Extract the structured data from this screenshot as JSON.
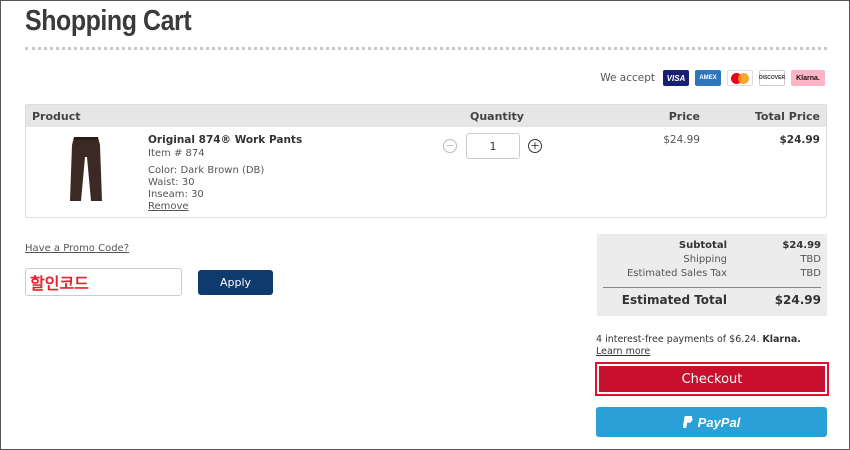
{
  "page": {
    "title": "Shopping Cart"
  },
  "payment": {
    "label": "We accept",
    "cards": [
      "VISA",
      "AMEX",
      "",
      "DISCOVER",
      "Klarna."
    ]
  },
  "table": {
    "headers": {
      "product": "Product",
      "quantity": "Quantity",
      "price": "Price",
      "total": "Total Price"
    }
  },
  "item": {
    "name": "Original 874® Work Pants",
    "item_no": "Item # 874",
    "color": "Color: Dark Brown (DB)",
    "waist": "Waist: 30",
    "inseam": "Inseam: 30",
    "remove": "Remove",
    "quantity": "1",
    "price": "$24.99",
    "total": "$24.99",
    "pants_color": "#3b2a23"
  },
  "promo": {
    "link": "Have a Promo Code?",
    "value": "할인코드",
    "apply": "Apply"
  },
  "summary": {
    "subtotal_label": "Subtotal",
    "subtotal": "$24.99",
    "shipping_label": "Shipping",
    "shipping": "TBD",
    "tax_label": "Estimated Sales Tax",
    "tax": "TBD",
    "est_label": "Estimated Total",
    "est": "$24.99"
  },
  "klarna": {
    "text": "4 interest-free payments of $6.24.",
    "brand": "Klarna.",
    "learn_more": "Learn more"
  },
  "buttons": {
    "checkout": "Checkout",
    "paypal": "PayPal"
  },
  "colors": {
    "checkout": "#c8102e",
    "apply": "#0e3a6e",
    "paypal": "#2a9fd8"
  }
}
